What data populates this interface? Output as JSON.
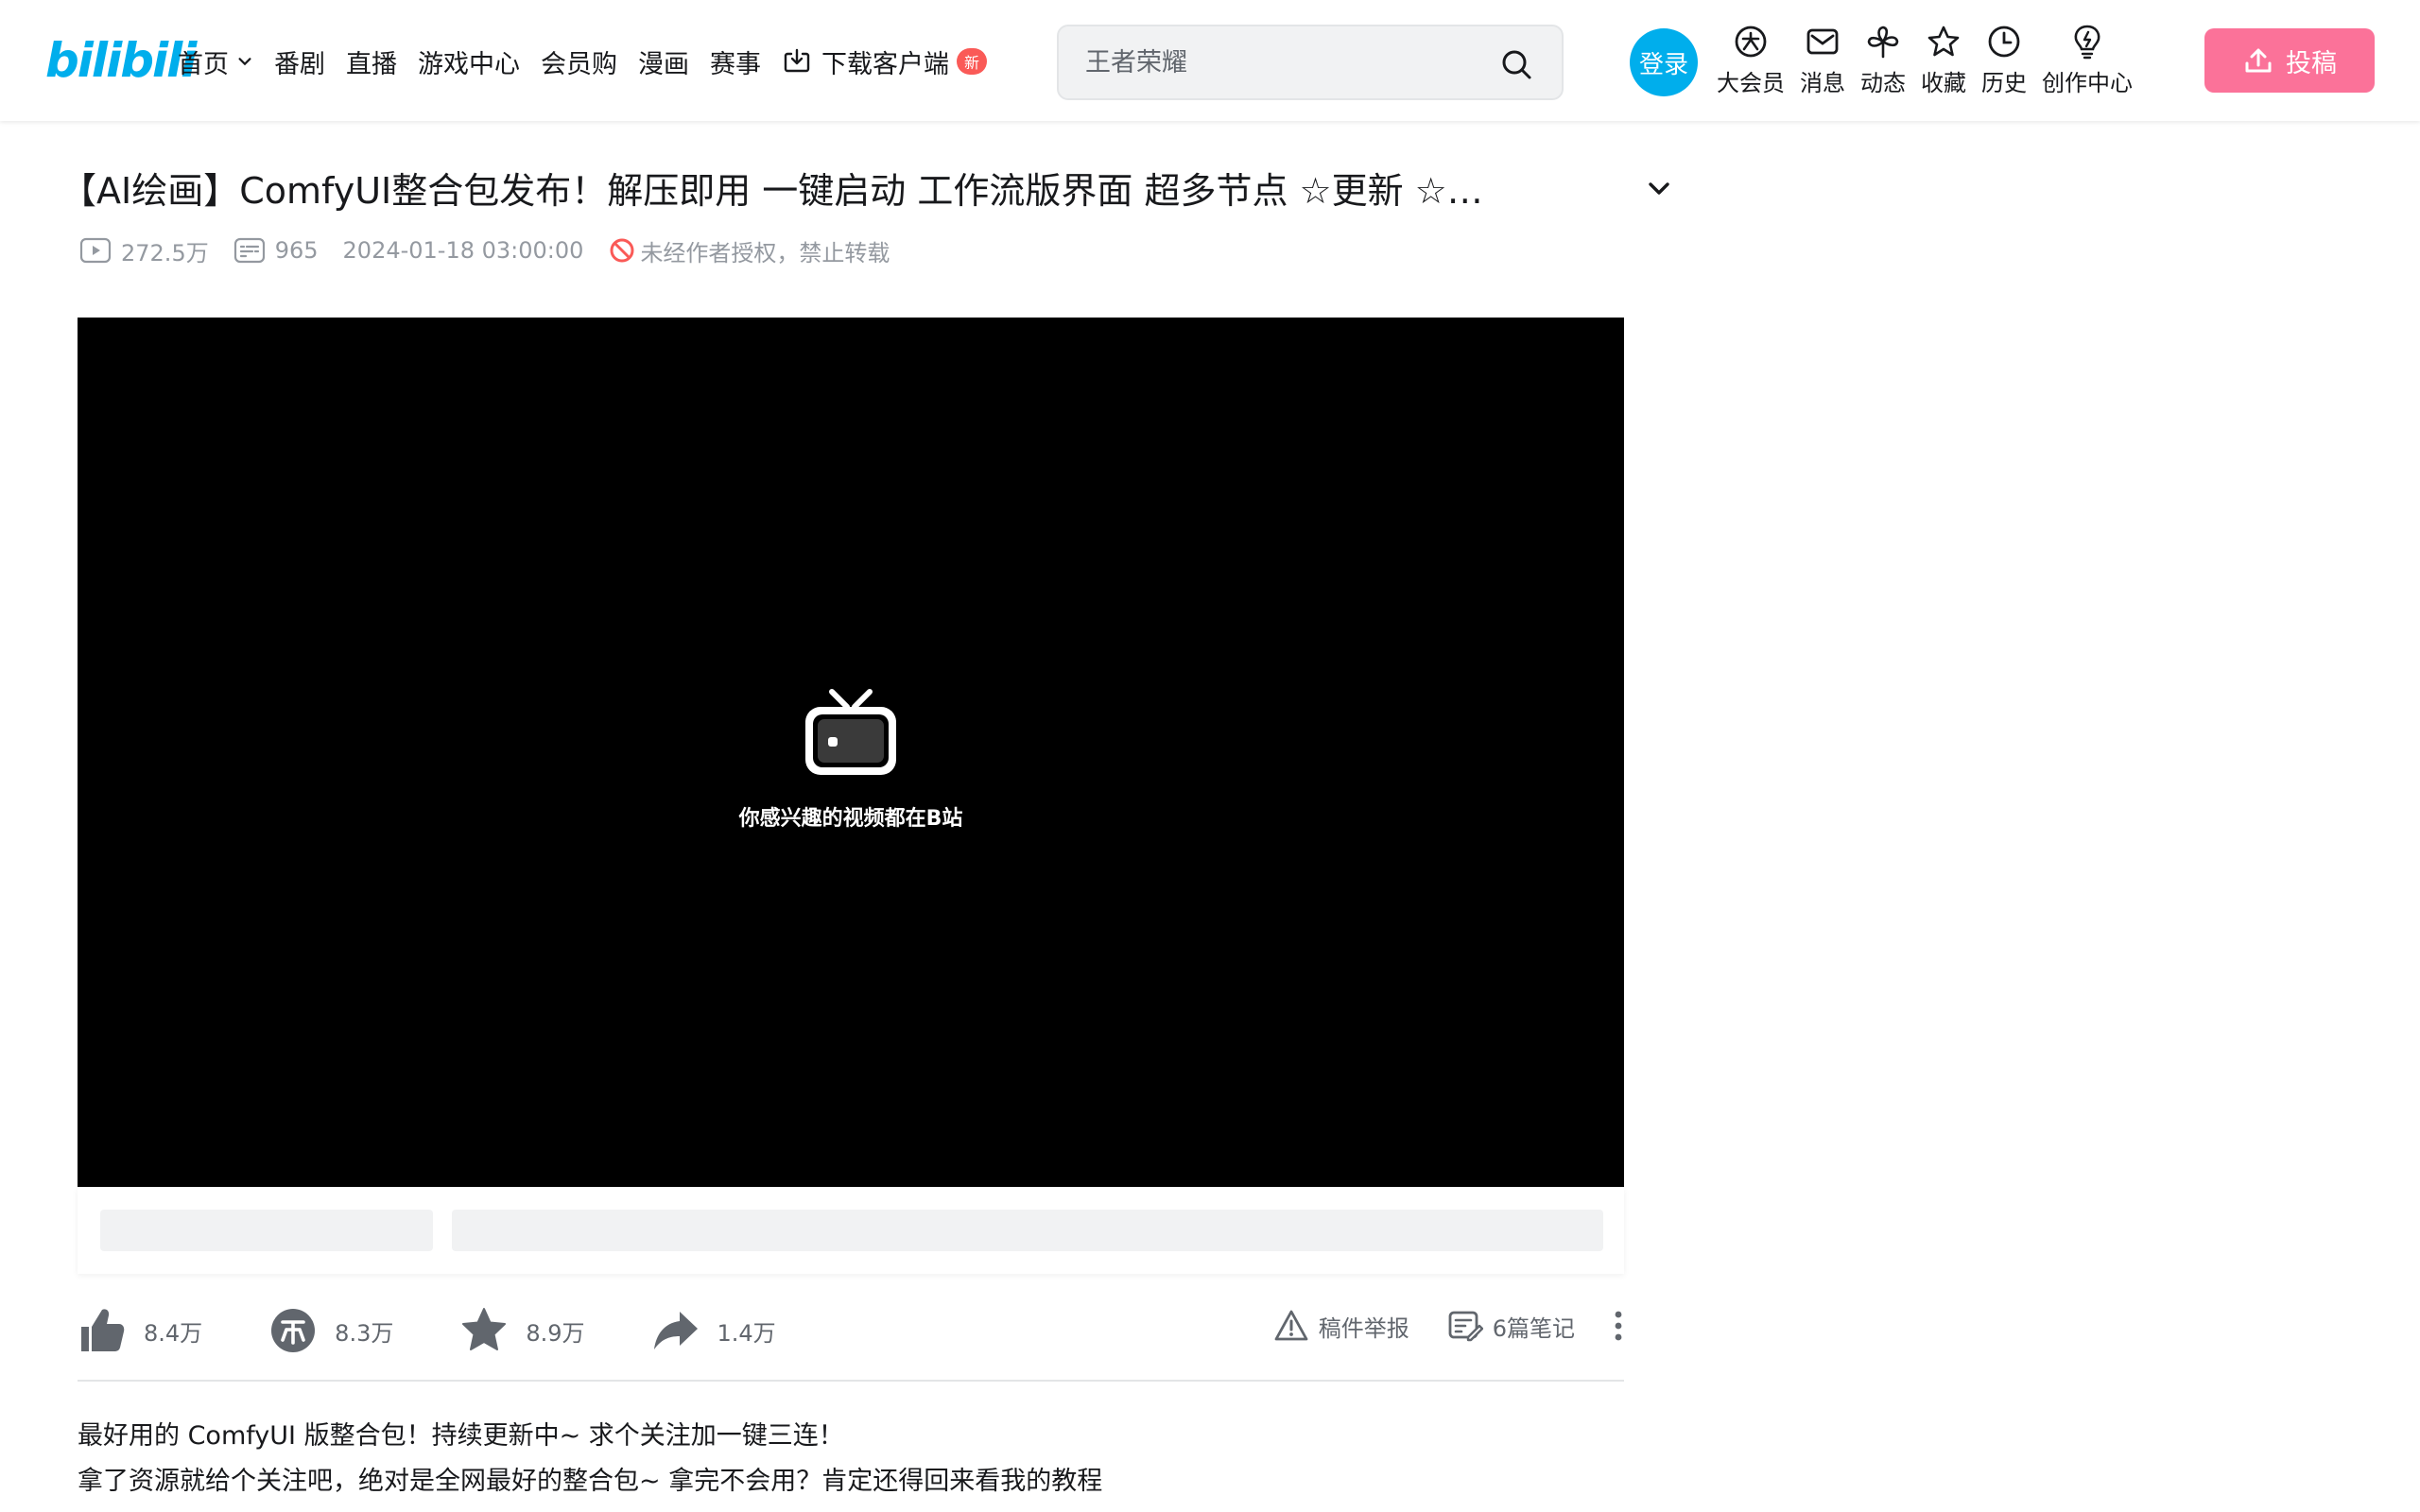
{
  "header": {
    "logo_text": "bilibili",
    "nav": [
      {
        "label": "首页"
      },
      {
        "label": "番剧"
      },
      {
        "label": "直播"
      },
      {
        "label": "游戏中心"
      },
      {
        "label": "会员购"
      },
      {
        "label": "漫画"
      },
      {
        "label": "赛事"
      },
      {
        "label": "下载客户端",
        "badge": "新"
      }
    ],
    "search_placeholder": "王者荣耀",
    "login_label": "登录",
    "entries": [
      {
        "label": "大会员",
        "icon": "vip-icon"
      },
      {
        "label": "消息",
        "icon": "message-icon"
      },
      {
        "label": "动态",
        "icon": "dynamic-icon"
      },
      {
        "label": "收藏",
        "icon": "favorite-icon"
      },
      {
        "label": "历史",
        "icon": "history-icon"
      },
      {
        "label": "创作中心",
        "icon": "creator-icon"
      }
    ],
    "upload_label": "投稿"
  },
  "video": {
    "title": "【AI绘画】ComfyUI整合包发布！解压即用 一键启动 工作流版界面 超多节点 ☆更新 ☆…",
    "views": "272.5万",
    "danmaku": "965",
    "pubdate": "2024-01-18 03:00:00",
    "copyright": "未经作者授权，禁止转载",
    "player_slogan": "你感兴趣的视频都在B站"
  },
  "toolbar": {
    "like": "8.4万",
    "coin": "8.3万",
    "favorite": "8.9万",
    "share": "1.4万",
    "report": "稿件举报",
    "notes": "6篇笔记"
  },
  "description": {
    "line1": "最好用的 ComfyUI 版整合包！持续更新中~ 求个关注加一键三连！",
    "line2": "拿了资源就给个关注吧，绝对是全网最好的整合包~ 拿完不会用？肯定还得回来看我的教程"
  },
  "colors": {
    "brand_blue": "#00aeec",
    "brand_pink": "#fb7299",
    "badge_red": "#fa5a57"
  }
}
